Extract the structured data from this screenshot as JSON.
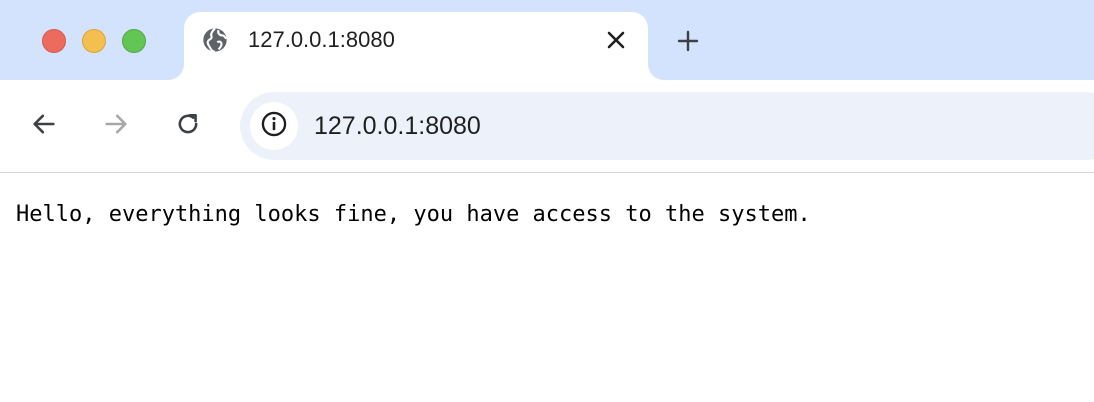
{
  "browser": {
    "tab": {
      "title": "127.0.0.1:8080",
      "favicon_icon": "globe-icon",
      "close_icon": "close-icon"
    },
    "new_tab_icon": "plus-icon",
    "toolbar": {
      "back_icon": "arrow-left-icon",
      "forward_icon": "arrow-right-icon",
      "reload_icon": "reload-icon",
      "site_info_icon": "info-icon"
    },
    "address_bar": {
      "url": "127.0.0.1:8080"
    },
    "colors": {
      "tabstrip": "#d3e3fd",
      "omnibox": "#edf2fa",
      "close_red": "#ed6a5e",
      "minimize_yellow": "#f5bf4f",
      "zoom_green": "#62c554"
    }
  },
  "page": {
    "body_text": "Hello, everything looks fine, you have access to the system."
  }
}
